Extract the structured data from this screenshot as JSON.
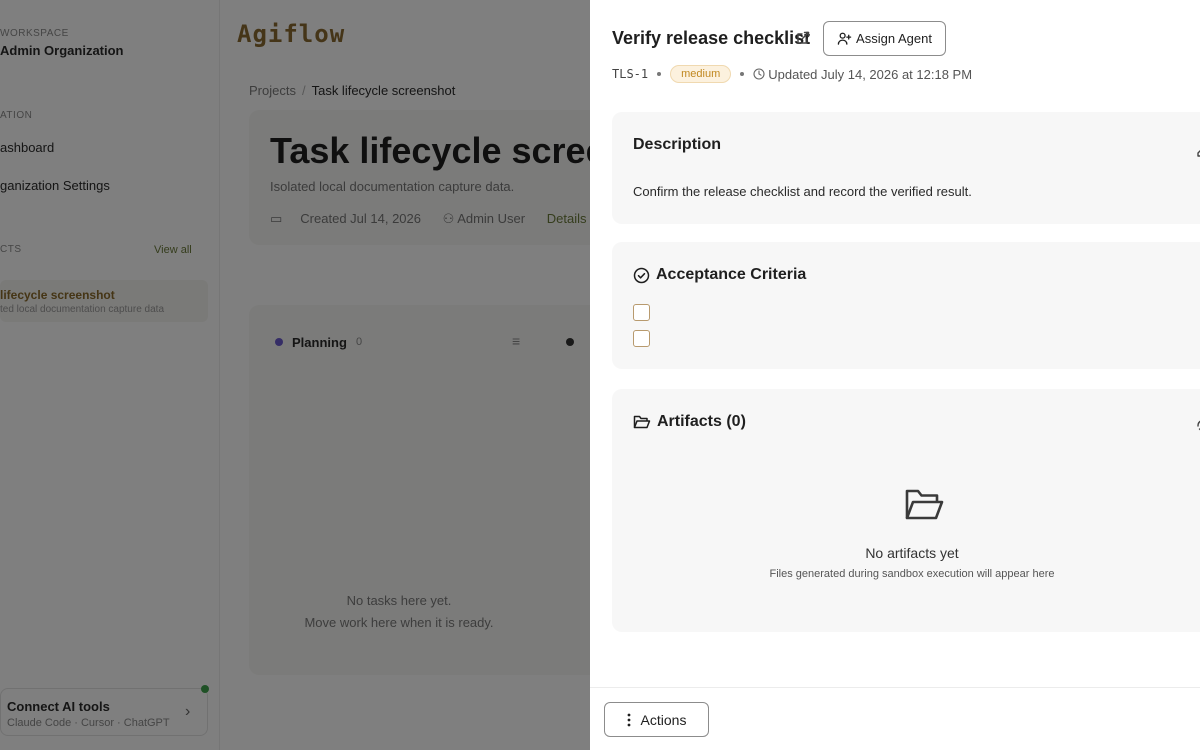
{
  "app": {
    "logo": "Agiflow",
    "sidebar": {
      "workspace_label": "WORKSPACE",
      "workspace_name": "Admin Organization",
      "nav_label": "ATION",
      "nav_items": [
        "ashboard",
        "ganization Settings"
      ],
      "projects_label": "CTS",
      "view_all": "View all",
      "project": {
        "name": "lifecycle screenshot",
        "desc": "ted local documentation capture data"
      },
      "connect": {
        "title": "Connect AI tools",
        "subtitle": "Claude Code · Cursor · ChatGPT"
      }
    },
    "breadcrumb": {
      "root": "Projects",
      "separator": "/",
      "current": "Task lifecycle screenshot"
    },
    "page": {
      "title": "Task lifecycle screens",
      "subtitle": "Isolated local documentation capture data.",
      "created": "Created Jul 14, 2026",
      "owner": "Admin User",
      "details": "Details"
    },
    "board": {
      "column_title": "Planning",
      "column_count": "0",
      "empty_line1": "No tasks here yet.",
      "empty_line2": "Move work here when it is ready."
    }
  },
  "drawer": {
    "title": "Verify release checklist",
    "assign_label": "Assign Agent",
    "task_id": "TLS-1",
    "priority": "medium",
    "updated": "Updated July 14, 2026 at 12:18 PM",
    "description": {
      "heading": "Description",
      "text": "Confirm the release checklist and record the verified result."
    },
    "acceptance": {
      "heading": "Acceptance Criteria",
      "items": [
        "",
        ""
      ]
    },
    "artifacts": {
      "heading": "Artifacts (0)",
      "empty_title": "No artifacts yet",
      "empty_sub": "Files generated during sandbox execution will appear here"
    },
    "actions_label": "Actions"
  },
  "colors": {
    "badge_bg": "#fcf1de",
    "badge_text": "#c08820",
    "overlay": "rgba(0,0,0,0.5)",
    "card_bg": "#f7f7f7"
  }
}
